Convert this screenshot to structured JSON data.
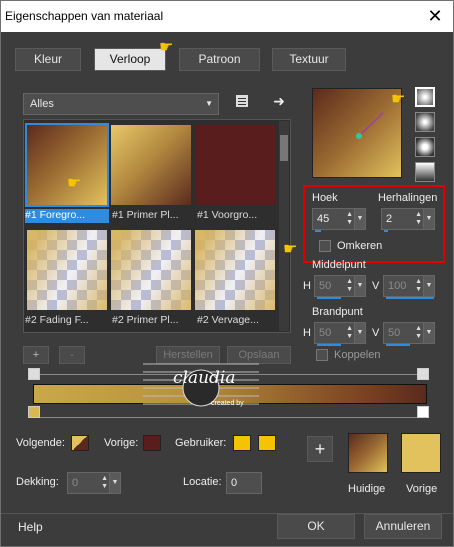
{
  "window": {
    "title": "Eigenschappen van materiaal",
    "close_glyph": "✕"
  },
  "tabs": [
    {
      "label": "Kleur",
      "active": false
    },
    {
      "label": "Verloop",
      "active": true
    },
    {
      "label": "Patroon",
      "active": false
    },
    {
      "label": "Textuur",
      "active": false
    }
  ],
  "category": {
    "selected": "Alles"
  },
  "gallery": {
    "items": [
      {
        "caption": "#1 Foregro...",
        "selected": true
      },
      {
        "caption": "#1 Primer Pl..."
      },
      {
        "caption": "#1 Voorgro..."
      },
      {
        "caption": "#2 Fading F..."
      },
      {
        "caption": "#2 Primer Pl..."
      },
      {
        "caption": "#2 Vervage..."
      }
    ]
  },
  "gradient_buttons": {
    "add": "+",
    "remove": "-",
    "restore": "Herstellen",
    "save": "Opslaan"
  },
  "settings": {
    "angle_label": "Hoek",
    "angle_value": "45",
    "repeats_label": "Herhalingen",
    "repeats_value": "2",
    "invert_label": "Omkeren",
    "midpoint_label": "Middelpunt",
    "midpoint_h_label": "H",
    "midpoint_h": "50",
    "midpoint_v_label": "V",
    "midpoint_v": "100",
    "focal_label": "Brandpunt",
    "focal_h_label": "H",
    "focal_h": "50",
    "focal_v_label": "V",
    "focal_v": "50",
    "link_label": "Koppelen"
  },
  "stops": {
    "next_label": "Volgende:",
    "prev_label": "Vorige:",
    "user_label": "Gebruiker:",
    "opacity_label": "Dekking:",
    "opacity_value": "0",
    "location_label": "Locatie:",
    "location_value": "0"
  },
  "swatches": {
    "current_label": "Huidige",
    "previous_label": "Vorige",
    "add_glyph": "+"
  },
  "watermark": {
    "text": "claudia",
    "sub": "created by"
  },
  "footer": {
    "help": "Help",
    "ok": "OK",
    "cancel": "Annuleren"
  },
  "colors": {
    "gold": "#e2c25c",
    "user_yellow": "#f4c400",
    "dark_red": "#5a1d1d",
    "selection_blue": "#2f8bdc",
    "highlight_red": "#e00000"
  }
}
